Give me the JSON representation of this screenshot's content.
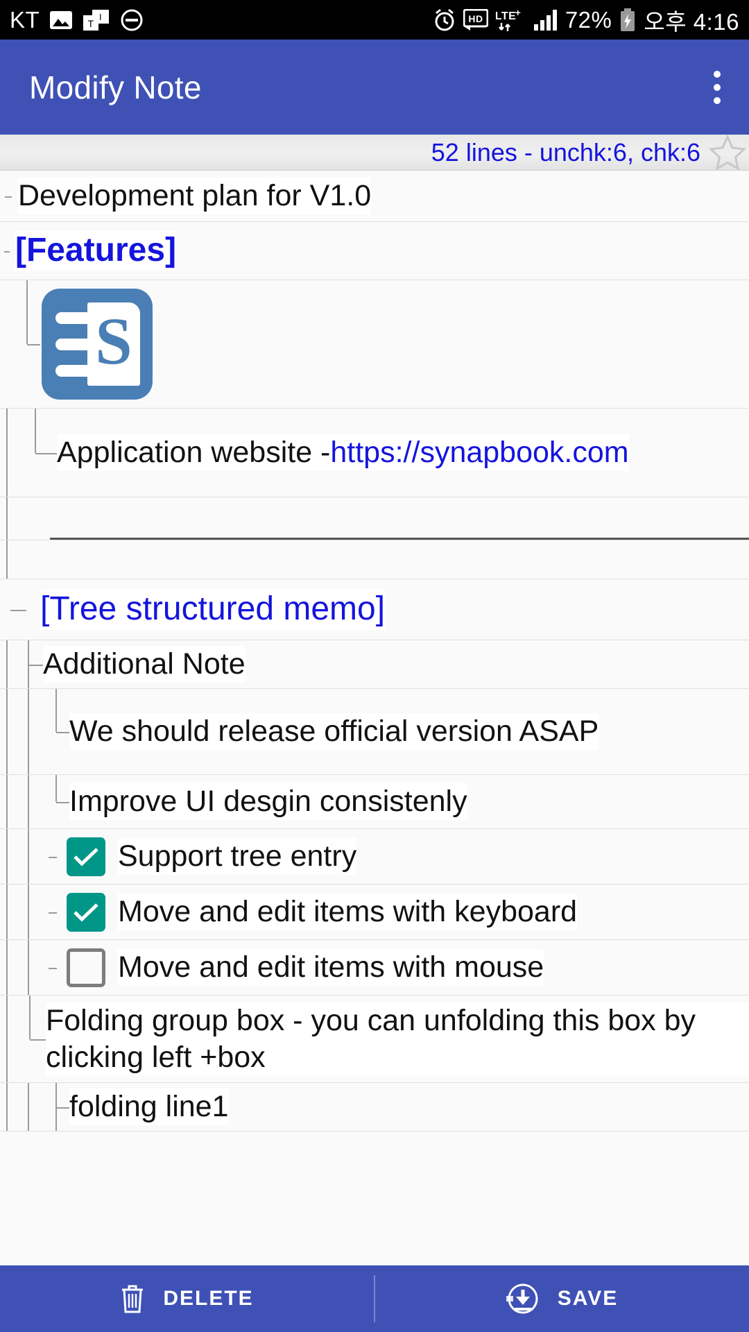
{
  "statusbar": {
    "carrier": "KT",
    "icons_left": [
      "image-icon",
      "text-input-icon",
      "do-not-disturb-icon"
    ],
    "icons_right": [
      "alarm-icon",
      "hd-icon",
      "lte-plus-icon",
      "signal-icon"
    ],
    "battery_percent": "72%",
    "battery_icon": "battery-charging-icon",
    "time": "오후 4:16"
  },
  "appbar": {
    "title": "Modify Note",
    "overflow_label": "overflow-menu",
    "background": "#3f51b5"
  },
  "infobar": {
    "stats": "52 lines - unchk:6, chk:6",
    "star_label": "favorite-star",
    "text_color": "#1414dd"
  },
  "note": {
    "rows": [
      {
        "text": "Development plan for V1.0"
      },
      {
        "text": "[Features]"
      },
      {
        "text": ""
      },
      {
        "text": "Application website - ",
        "link": "https://synapbook.com"
      },
      {
        "text": ""
      },
      {
        "text": "[Tree structured memo]"
      },
      {
        "text": "Additional Note"
      },
      {
        "text": "We should release official version ASAP"
      },
      {
        "text": "Improve UI desgin consistenly"
      },
      {
        "text": "Support tree entry",
        "checkbox": "checked"
      },
      {
        "text": "Move and edit items with keyboard",
        "checkbox": "checked"
      },
      {
        "text": "Move and edit items with mouse",
        "checkbox": "unchecked"
      },
      {
        "text": "Folding group box - you can unfolding this box by clicking left +box"
      },
      {
        "text": "folding line1"
      }
    ],
    "app_icon_letter": "S",
    "checkbox_checked_color": "#009688",
    "checkbox_unchecked_color": "#7d7d7d",
    "link_color": "#1414dd"
  },
  "bottombar": {
    "delete_label": "DELETE",
    "save_label": "SAVE",
    "background": "#3f51b5"
  }
}
